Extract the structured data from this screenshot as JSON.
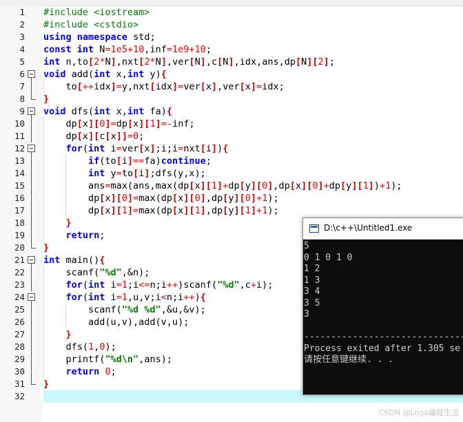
{
  "editor": {
    "line_numbers": [
      "1",
      "2",
      "3",
      "4",
      "5",
      "6",
      "7",
      "8",
      "9",
      "10",
      "11",
      "12",
      "13",
      "14",
      "15",
      "16",
      "17",
      "18",
      "19",
      "20",
      "21",
      "22",
      "23",
      "24",
      "25",
      "26",
      "27",
      "28",
      "29",
      "30",
      "31",
      "32"
    ],
    "code_lines": [
      [
        [
          "pp",
          "#include <iostream>"
        ]
      ],
      [
        [
          "pp",
          "#include <cstdio>"
        ]
      ],
      [
        [
          "kw",
          "using"
        ],
        [
          "t",
          " "
        ],
        [
          "kw",
          "namespace"
        ],
        [
          "t",
          " std;"
        ]
      ],
      [
        [
          "kw",
          "const"
        ],
        [
          "t",
          " "
        ],
        [
          "kw",
          "int"
        ],
        [
          "t",
          " N"
        ],
        [
          "op",
          "="
        ],
        [
          "num",
          "1e5"
        ],
        [
          "op",
          "+"
        ],
        [
          "num",
          "10"
        ],
        [
          "t",
          ",inf"
        ],
        [
          "op",
          "="
        ],
        [
          "num",
          "1e9"
        ],
        [
          "op",
          "+"
        ],
        [
          "num",
          "10"
        ],
        [
          "t",
          ";"
        ]
      ],
      [
        [
          "kw",
          "int"
        ],
        [
          "t",
          " n,to"
        ],
        [
          "br",
          "["
        ],
        [
          "num",
          "2"
        ],
        [
          "op",
          "*"
        ],
        [
          "t",
          "N"
        ],
        [
          "br",
          "]"
        ],
        [
          "t",
          ",nxt"
        ],
        [
          "br",
          "["
        ],
        [
          "num",
          "2"
        ],
        [
          "op",
          "*"
        ],
        [
          "t",
          "N"
        ],
        [
          "br",
          "]"
        ],
        [
          "t",
          ",ver"
        ],
        [
          "br",
          "["
        ],
        [
          "t",
          "N"
        ],
        [
          "br",
          "]"
        ],
        [
          "t",
          ",c"
        ],
        [
          "br",
          "["
        ],
        [
          "t",
          "N"
        ],
        [
          "br",
          "]"
        ],
        [
          "t",
          ",idx,ans,dp"
        ],
        [
          "br",
          "["
        ],
        [
          "t",
          "N"
        ],
        [
          "br",
          "]["
        ],
        [
          "num",
          "2"
        ],
        [
          "br",
          "]"
        ],
        [
          "t",
          ";"
        ]
      ],
      [
        [
          "kw",
          "void"
        ],
        [
          "t",
          " add("
        ],
        [
          "kw",
          "int"
        ],
        [
          "t",
          " x,"
        ],
        [
          "kw",
          "int"
        ],
        [
          "t",
          " y)"
        ],
        [
          "br",
          "{"
        ]
      ],
      [
        [
          "t",
          "    to"
        ],
        [
          "br",
          "["
        ],
        [
          "op",
          "++"
        ],
        [
          "t",
          "idx"
        ],
        [
          "br",
          "]"
        ],
        [
          "op",
          "="
        ],
        [
          "t",
          "y,nxt"
        ],
        [
          "br",
          "["
        ],
        [
          "t",
          "idx"
        ],
        [
          "br",
          "]"
        ],
        [
          "op",
          "="
        ],
        [
          "t",
          "ver"
        ],
        [
          "br",
          "["
        ],
        [
          "t",
          "x"
        ],
        [
          "br",
          "]"
        ],
        [
          "t",
          ",ver"
        ],
        [
          "br",
          "["
        ],
        [
          "t",
          "x"
        ],
        [
          "br",
          "]"
        ],
        [
          "op",
          "="
        ],
        [
          "t",
          "idx;"
        ]
      ],
      [
        [
          "br",
          "}"
        ]
      ],
      [
        [
          "kw",
          "void"
        ],
        [
          "t",
          " dfs("
        ],
        [
          "kw",
          "int"
        ],
        [
          "t",
          " x,"
        ],
        [
          "kw",
          "int"
        ],
        [
          "t",
          " fa)"
        ],
        [
          "br",
          "{"
        ]
      ],
      [
        [
          "t",
          "    dp"
        ],
        [
          "br",
          "["
        ],
        [
          "t",
          "x"
        ],
        [
          "br",
          "]["
        ],
        [
          "num",
          "0"
        ],
        [
          "br",
          "]"
        ],
        [
          "op",
          "="
        ],
        [
          "t",
          "dp"
        ],
        [
          "br",
          "["
        ],
        [
          "t",
          "x"
        ],
        [
          "br",
          "]["
        ],
        [
          "num",
          "1"
        ],
        [
          "br",
          "]"
        ],
        [
          "op",
          "=-"
        ],
        [
          "t",
          "inf;"
        ]
      ],
      [
        [
          "t",
          "    dp"
        ],
        [
          "br",
          "["
        ],
        [
          "t",
          "x"
        ],
        [
          "br",
          "]["
        ],
        [
          "t",
          "c"
        ],
        [
          "br",
          "["
        ],
        [
          "t",
          "x"
        ],
        [
          "br",
          "]]"
        ],
        [
          "op",
          "="
        ],
        [
          "num",
          "0"
        ],
        [
          "t",
          ";"
        ]
      ],
      [
        [
          "t",
          "    "
        ],
        [
          "kw",
          "for"
        ],
        [
          "t",
          "("
        ],
        [
          "kw",
          "int"
        ],
        [
          "t",
          " i"
        ],
        [
          "op",
          "="
        ],
        [
          "t",
          "ver"
        ],
        [
          "br",
          "["
        ],
        [
          "t",
          "x"
        ],
        [
          "br",
          "]"
        ],
        [
          "t",
          ";i;i"
        ],
        [
          "op",
          "="
        ],
        [
          "t",
          "nxt"
        ],
        [
          "br",
          "["
        ],
        [
          "t",
          "i"
        ],
        [
          "br",
          "]"
        ],
        [
          "t",
          ")"
        ],
        [
          "br",
          "{"
        ]
      ],
      [
        [
          "t",
          "        "
        ],
        [
          "kw",
          "if"
        ],
        [
          "t",
          "(to"
        ],
        [
          "br",
          "["
        ],
        [
          "t",
          "i"
        ],
        [
          "br",
          "]"
        ],
        [
          "op",
          "=="
        ],
        [
          "t",
          "fa)"
        ],
        [
          "kw",
          "continue"
        ],
        [
          "t",
          ";"
        ]
      ],
      [
        [
          "t",
          "        "
        ],
        [
          "kw",
          "int"
        ],
        [
          "t",
          " y"
        ],
        [
          "op",
          "="
        ],
        [
          "t",
          "to"
        ],
        [
          "br",
          "["
        ],
        [
          "t",
          "i"
        ],
        [
          "br",
          "]"
        ],
        [
          "t",
          ";dfs(y,x);"
        ]
      ],
      [
        [
          "t",
          "        ans"
        ],
        [
          "op",
          "="
        ],
        [
          "t",
          "max(ans,max(dp"
        ],
        [
          "br",
          "["
        ],
        [
          "t",
          "x"
        ],
        [
          "br",
          "]["
        ],
        [
          "num",
          "1"
        ],
        [
          "br",
          "]"
        ],
        [
          "op",
          "+"
        ],
        [
          "t",
          "dp"
        ],
        [
          "br",
          "["
        ],
        [
          "t",
          "y"
        ],
        [
          "br",
          "]["
        ],
        [
          "num",
          "0"
        ],
        [
          "br",
          "]"
        ],
        [
          "t",
          ",dp"
        ],
        [
          "br",
          "["
        ],
        [
          "t",
          "x"
        ],
        [
          "br",
          "]["
        ],
        [
          "num",
          "0"
        ],
        [
          "br",
          "]"
        ],
        [
          "op",
          "+"
        ],
        [
          "t",
          "dp"
        ],
        [
          "br",
          "["
        ],
        [
          "t",
          "y"
        ],
        [
          "br",
          "]["
        ],
        [
          "num",
          "1"
        ],
        [
          "br",
          "]"
        ],
        [
          "t",
          ")"
        ],
        [
          "op",
          "+"
        ],
        [
          "num",
          "1"
        ],
        [
          "t",
          ");"
        ]
      ],
      [
        [
          "t",
          "        dp"
        ],
        [
          "br",
          "["
        ],
        [
          "t",
          "x"
        ],
        [
          "br",
          "]["
        ],
        [
          "num",
          "0"
        ],
        [
          "br",
          "]"
        ],
        [
          "op",
          "="
        ],
        [
          "t",
          "max(dp"
        ],
        [
          "br",
          "["
        ],
        [
          "t",
          "x"
        ],
        [
          "br",
          "]["
        ],
        [
          "num",
          "0"
        ],
        [
          "br",
          "]"
        ],
        [
          "t",
          ",dp"
        ],
        [
          "br",
          "["
        ],
        [
          "t",
          "y"
        ],
        [
          "br",
          "]["
        ],
        [
          "num",
          "0"
        ],
        [
          "br",
          "]"
        ],
        [
          "op",
          "+"
        ],
        [
          "num",
          "1"
        ],
        [
          "t",
          ");"
        ]
      ],
      [
        [
          "t",
          "        dp"
        ],
        [
          "br",
          "["
        ],
        [
          "t",
          "x"
        ],
        [
          "br",
          "]["
        ],
        [
          "num",
          "1"
        ],
        [
          "br",
          "]"
        ],
        [
          "op",
          "="
        ],
        [
          "t",
          "max(dp"
        ],
        [
          "br",
          "["
        ],
        [
          "t",
          "x"
        ],
        [
          "br",
          "]["
        ],
        [
          "num",
          "1"
        ],
        [
          "br",
          "]"
        ],
        [
          "t",
          ",dp"
        ],
        [
          "br",
          "["
        ],
        [
          "t",
          "y"
        ],
        [
          "br",
          "]["
        ],
        [
          "num",
          "1"
        ],
        [
          "br",
          "]"
        ],
        [
          "op",
          "+"
        ],
        [
          "num",
          "1"
        ],
        [
          "t",
          ");"
        ]
      ],
      [
        [
          "t",
          "    "
        ],
        [
          "br",
          "}"
        ]
      ],
      [
        [
          "t",
          "    "
        ],
        [
          "kw",
          "return"
        ],
        [
          "t",
          ";"
        ]
      ],
      [
        [
          "br",
          "}"
        ]
      ],
      [
        [
          "kw",
          "int"
        ],
        [
          "t",
          " main()"
        ],
        [
          "br",
          "{"
        ]
      ],
      [
        [
          "t",
          "    scanf("
        ],
        [
          "str",
          "\"%d\""
        ],
        [
          "t",
          ",&n);"
        ]
      ],
      [
        [
          "t",
          "    "
        ],
        [
          "kw",
          "for"
        ],
        [
          "t",
          "("
        ],
        [
          "kw",
          "int"
        ],
        [
          "t",
          " i"
        ],
        [
          "op",
          "="
        ],
        [
          "num",
          "1"
        ],
        [
          "t",
          ";i"
        ],
        [
          "op",
          "<="
        ],
        [
          "t",
          "n;i"
        ],
        [
          "op",
          "++"
        ],
        [
          "t",
          ")scanf("
        ],
        [
          "str",
          "\"%d\""
        ],
        [
          "t",
          ",c"
        ],
        [
          "op",
          "+"
        ],
        [
          "t",
          "i);"
        ]
      ],
      [
        [
          "t",
          "    "
        ],
        [
          "kw",
          "for"
        ],
        [
          "t",
          "("
        ],
        [
          "kw",
          "int"
        ],
        [
          "t",
          " i"
        ],
        [
          "op",
          "="
        ],
        [
          "num",
          "1"
        ],
        [
          "t",
          ",u,v;i"
        ],
        [
          "op",
          "<"
        ],
        [
          "t",
          "n;i"
        ],
        [
          "op",
          "++"
        ],
        [
          "t",
          ")"
        ],
        [
          "br",
          "{"
        ]
      ],
      [
        [
          "t",
          "        scanf("
        ],
        [
          "str",
          "\"%d %d\""
        ],
        [
          "t",
          ",&u,&v);"
        ]
      ],
      [
        [
          "t",
          "        add(u,v),add(v,u);"
        ]
      ],
      [
        [
          "t",
          "    "
        ],
        [
          "br",
          "}"
        ]
      ],
      [
        [
          "t",
          "    dfs("
        ],
        [
          "num",
          "1"
        ],
        [
          "t",
          ","
        ],
        [
          "num",
          "0"
        ],
        [
          "t",
          ");"
        ]
      ],
      [
        [
          "t",
          "    printf("
        ],
        [
          "str",
          "\"%d\\n\""
        ],
        [
          "t",
          ",ans);"
        ]
      ],
      [
        [
          "t",
          "    "
        ],
        [
          "kw",
          "return"
        ],
        [
          "t",
          " "
        ],
        [
          "num",
          "0"
        ],
        [
          "t",
          ";"
        ]
      ],
      [
        [
          "br",
          "}"
        ]
      ],
      [
        [
          "t",
          ""
        ]
      ]
    ],
    "fold_markers": [
      "",
      "",
      "",
      "",
      "",
      "open",
      "line",
      "end",
      "open",
      "line",
      "line",
      "open",
      "line",
      "line",
      "line",
      "line",
      "line",
      "line",
      "line",
      "end",
      "open",
      "line",
      "line",
      "open",
      "line",
      "line",
      "line",
      "line",
      "line",
      "line",
      "end",
      ""
    ],
    "current_line": 32
  },
  "console": {
    "title": "D:\\c++\\Untitled1.exe",
    "lines": [
      "5",
      "0 1 0 1 0",
      "1 2",
      "1 3",
      "3 4",
      "3 5",
      "3",
      "",
      "--------------------------------",
      "Process exited after 1.305 se",
      "请按任意键继续. . ."
    ]
  },
  "watermark": "CSDN @Loga编程生活"
}
